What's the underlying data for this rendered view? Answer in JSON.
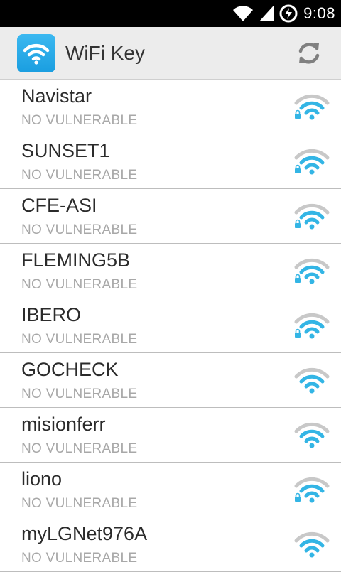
{
  "status_bar": {
    "time": "9:08"
  },
  "app_bar": {
    "title": "WiFi Key"
  },
  "colors": {
    "accent": "#33b5e5",
    "signal_inactive": "#c8c8c8"
  },
  "networks": [
    {
      "name": "Navistar",
      "status": "NO VULNERABLE",
      "locked": true,
      "icon": "wifi-locked-icon"
    },
    {
      "name": "SUNSET1",
      "status": "NO VULNERABLE",
      "locked": true,
      "icon": "wifi-locked-icon"
    },
    {
      "name": "CFE-ASI",
      "status": "NO VULNERABLE",
      "locked": true,
      "icon": "wifi-locked-icon"
    },
    {
      "name": "FLEMING5B",
      "status": "NO VULNERABLE",
      "locked": true,
      "icon": "wifi-locked-icon"
    },
    {
      "name": "IBERO",
      "status": "NO VULNERABLE",
      "locked": true,
      "icon": "wifi-locked-icon"
    },
    {
      "name": "GOCHECK",
      "status": "NO VULNERABLE",
      "locked": false,
      "icon": "wifi-icon"
    },
    {
      "name": "misionferr",
      "status": "NO VULNERABLE",
      "locked": false,
      "icon": "wifi-icon"
    },
    {
      "name": "liono",
      "status": "NO VULNERABLE",
      "locked": true,
      "icon": "wifi-locked-icon"
    },
    {
      "name": "myLGNet976A",
      "status": "NO VULNERABLE",
      "locked": false,
      "icon": "wifi-icon"
    }
  ]
}
